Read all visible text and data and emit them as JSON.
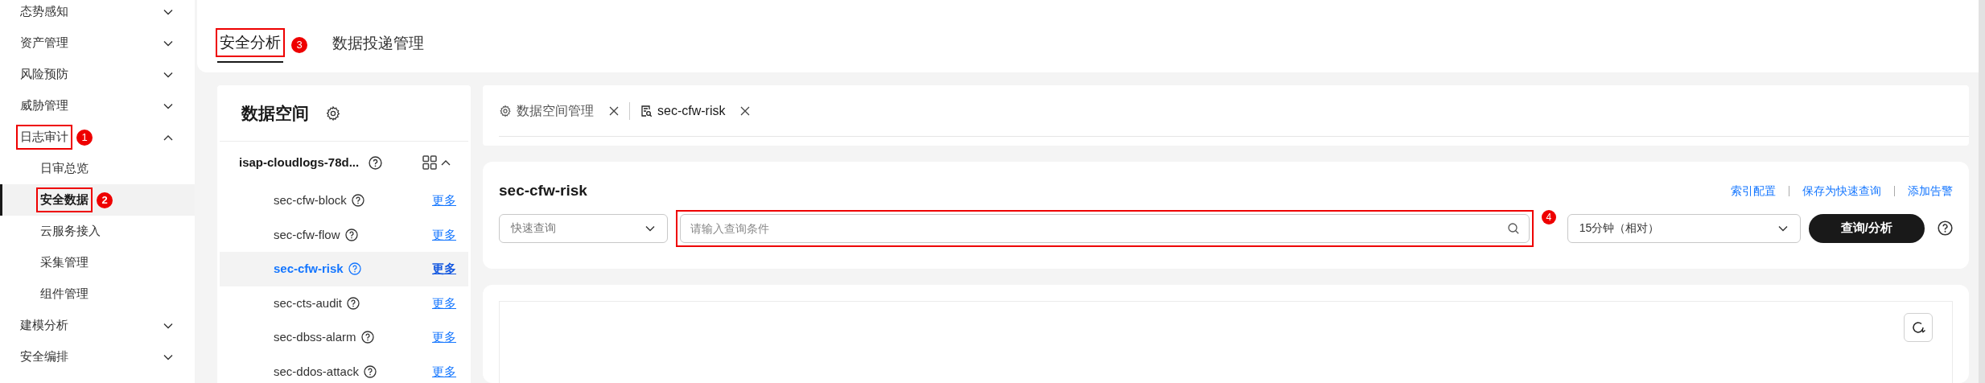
{
  "sidebar": {
    "items": [
      {
        "label": "态势感知",
        "expanded": false,
        "highlighted": false
      },
      {
        "label": "资产管理",
        "expanded": false,
        "highlighted": false
      },
      {
        "label": "风险预防",
        "expanded": false,
        "highlighted": false
      },
      {
        "label": "威胁管理",
        "expanded": false,
        "highlighted": false
      },
      {
        "label": "日志审计",
        "expanded": true,
        "highlighted": true,
        "marker": "1",
        "children": [
          {
            "label": "日审总览",
            "selected": false,
            "highlighted": false
          },
          {
            "label": "安全数据",
            "selected": true,
            "highlighted": true,
            "marker": "2"
          },
          {
            "label": "云服务接入",
            "selected": false,
            "highlighted": false
          },
          {
            "label": "采集管理",
            "selected": false,
            "highlighted": false
          },
          {
            "label": "组件管理",
            "selected": false,
            "highlighted": false
          }
        ]
      },
      {
        "label": "建模分析",
        "expanded": false,
        "highlighted": false
      },
      {
        "label": "安全编排",
        "expanded": false,
        "highlighted": false
      }
    ]
  },
  "top_tabs": [
    {
      "label": "安全分析",
      "selected": true,
      "highlighted": true,
      "marker": "3"
    },
    {
      "label": "数据投递管理",
      "selected": false,
      "highlighted": false
    }
  ],
  "data_space": {
    "title": "数据空间",
    "group": {
      "name": "isap-cloudlogs-78d...",
      "expanded": true,
      "streams": [
        {
          "name": "sec-cfw-block",
          "selected": false,
          "action": "更多"
        },
        {
          "name": "sec-cfw-flow",
          "selected": false,
          "action": "更多"
        },
        {
          "name": "sec-cfw-risk",
          "selected": true,
          "action": "更多"
        },
        {
          "name": "sec-cts-audit",
          "selected": false,
          "action": "更多"
        },
        {
          "name": "sec-dbss-alarm",
          "selected": false,
          "action": "更多"
        },
        {
          "name": "sec-ddos-attack",
          "selected": false,
          "action": "更多"
        }
      ]
    }
  },
  "open_tabs": [
    {
      "kind": "settings",
      "label": "数据空间管理",
      "selected": false
    },
    {
      "kind": "query",
      "label": "sec-cfw-risk",
      "selected": true
    }
  ],
  "query": {
    "title": "sec-cfw-risk",
    "links": [
      "索引配置",
      "保存为快速查询",
      "添加告警"
    ],
    "quick_query": {
      "placeholder": "快速查询"
    },
    "search": {
      "placeholder": "请输入查询条件",
      "highlighted": true,
      "marker": "4"
    },
    "time_range": "15分钟（相对）",
    "button": "查询/分析"
  }
}
